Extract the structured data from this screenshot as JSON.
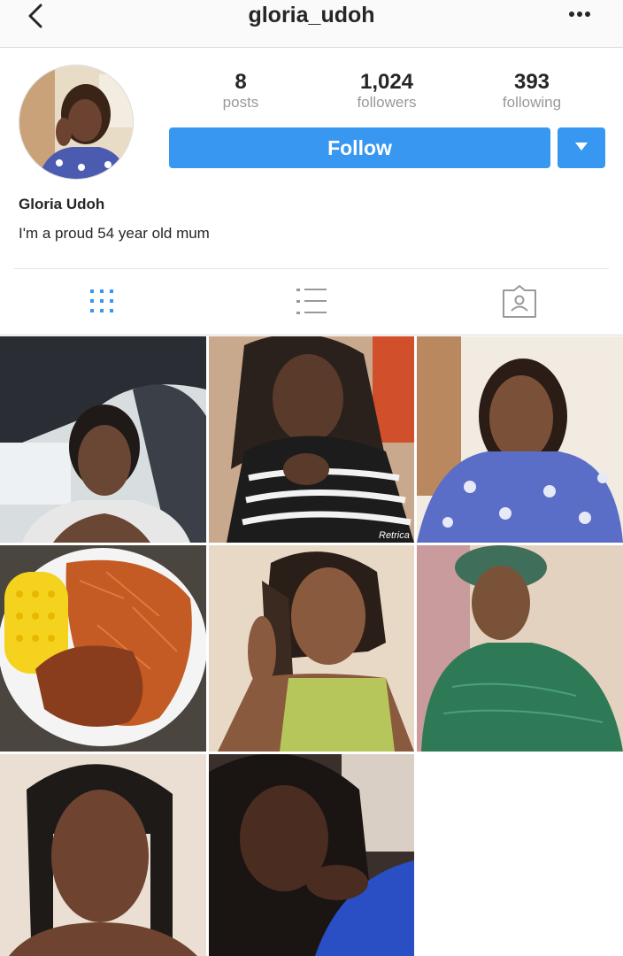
{
  "header": {
    "username": "gloria_udoh"
  },
  "profile": {
    "display_name": "Gloria Udoh",
    "bio": "I'm a proud 54 year old mum",
    "stats": [
      {
        "value": "8",
        "label": "posts"
      },
      {
        "value": "1,024",
        "label": "followers"
      },
      {
        "value": "393",
        "label": "following"
      }
    ],
    "follow_label": "Follow"
  },
  "tabs": [
    {
      "name": "grid-view",
      "active": true
    },
    {
      "name": "list-view",
      "active": false
    },
    {
      "name": "tagged-view",
      "active": false
    }
  ],
  "colors": {
    "accent": "#3897f0",
    "muted": "#999999",
    "text": "#262626"
  },
  "posts": [
    {
      "kind": "selfie-in-car"
    },
    {
      "kind": "selfie-striped-top",
      "watermark": "Retrica"
    },
    {
      "kind": "portrait-blue-floral"
    },
    {
      "kind": "food-plate-rice-corn-chicken"
    },
    {
      "kind": "portrait-braids-green"
    },
    {
      "kind": "portrait-green-dress-headwrap"
    },
    {
      "kind": "portrait-braids"
    },
    {
      "kind": "selfie-blue-top"
    }
  ]
}
